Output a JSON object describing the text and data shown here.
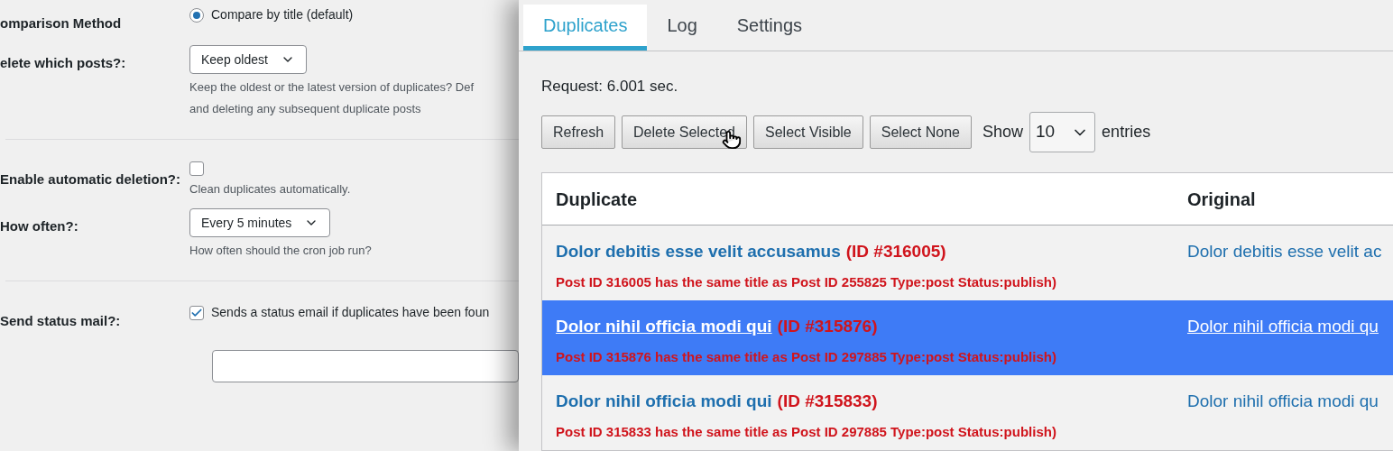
{
  "settings_panel": {
    "rows": [
      {
        "kind": "radio",
        "label": "omparison Method",
        "option": "Compare by title (default)",
        "selected": true
      },
      {
        "kind": "select",
        "label": "elete which posts?:",
        "value": "Keep oldest",
        "hint_lines": [
          "Keep the oldest or the latest version of duplicates? Def",
          "and deleting any subsequent duplicate posts"
        ]
      },
      {
        "kind": "divider"
      },
      {
        "kind": "checkbox",
        "label": "Enable automatic deletion?:",
        "checked": false,
        "hint_lines": [
          "Clean duplicates automatically."
        ]
      },
      {
        "kind": "select",
        "label": "How often?:",
        "value": "Every 5 minutes",
        "hint_lines": [
          "How often should the cron job run?"
        ]
      },
      {
        "kind": "divider"
      },
      {
        "kind": "checkbox",
        "label": "Send status mail?:",
        "checked": true,
        "option": "Sends a status email if duplicates have been foun"
      },
      {
        "kind": "field"
      }
    ]
  },
  "duplicates_panel": {
    "tabs": [
      {
        "label": "Duplicates",
        "selected": true
      },
      {
        "label": "Log",
        "selected": false
      },
      {
        "label": "Settings",
        "selected": false
      }
    ],
    "request_time": "Request: 6.001 sec.",
    "buttons": [
      "Refresh",
      "Delete Selected",
      "Select Visible",
      "Select None"
    ],
    "show_label": "Show",
    "page_size": "10",
    "entries_label": "entries",
    "table": {
      "columns": [
        "Duplicate",
        "Original"
      ],
      "rows": [
        {
          "title": "Dolor debitis esse velit accusamus",
          "id": "(ID #316005)",
          "note": "Post ID 316005 has the same title as Post ID 255825 Type:post Status:publish)",
          "original": "Dolor debitis esse velit ac",
          "selected": false
        },
        {
          "title": "Dolor nihil officia modi qui",
          "id": "(ID #315876)",
          "note": "Post ID 315876 has the same title as Post ID 297885 Type:post Status:publish)",
          "original": "Dolor nihil officia modi qu",
          "selected": true
        },
        {
          "title": "Dolor nihil officia modi qui",
          "id": "(ID #315833)",
          "note": "Post ID 315833 has the same title as Post ID 297885 Type:post Status:publish)",
          "original": "Dolor nihil officia modi qu",
          "selected": false
        }
      ]
    }
  }
}
